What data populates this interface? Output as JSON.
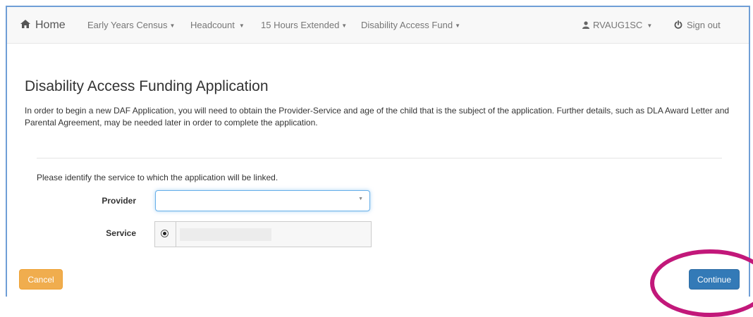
{
  "navbar": {
    "home_label": "Home",
    "items": [
      {
        "label": "Early Years Census",
        "has_caret": true
      },
      {
        "label": "Headcount",
        "has_caret": true
      },
      {
        "label": "15 Hours Extended",
        "has_caret": true
      },
      {
        "label": "Disability Access Fund",
        "has_caret": true
      }
    ],
    "user_label": "RVAUG1SC",
    "signout_label": "Sign out",
    "icons": {
      "home": "home-icon",
      "user": "user-icon",
      "signout": "power-icon",
      "dropdown": "caret-down-icon"
    }
  },
  "page": {
    "title": "Disability Access Funding Application",
    "intro": "In order to begin a new DAF Application, you will need to obtain the Provider-Service and age of the child that is the subject of the application. Further details, such as DLA Award Letter and Parental Agreement, may be needed later in order to complete the application.",
    "instruction": "Please identify the service to which the application will be linked."
  },
  "form": {
    "provider_label": "Provider",
    "provider_value": "",
    "service_label": "Service",
    "service_selected": true
  },
  "buttons": {
    "cancel_label": "Cancel",
    "continue_label": "Continue"
  },
  "colors": {
    "cancel": "#f0ad4e",
    "continue": "#337ab7",
    "highlight_ring": "#c2187a",
    "focus_border": "#66afe9"
  }
}
